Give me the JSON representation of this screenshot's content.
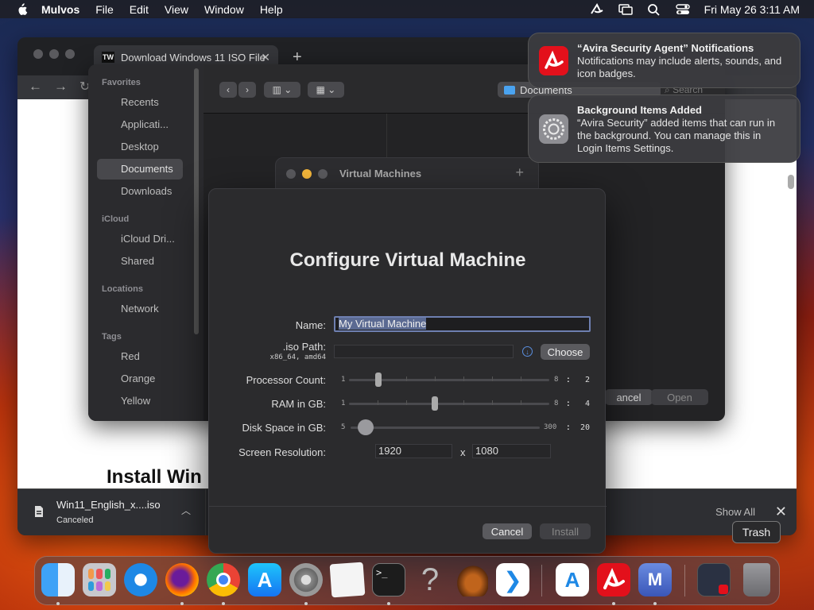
{
  "menubar": {
    "app_name": "Mulvos",
    "items": [
      "File",
      "Edit",
      "View",
      "Window",
      "Help"
    ],
    "datetime": "Fri May 26  3:11 AM"
  },
  "browser": {
    "tab_title": "Download Windows 11 ISO File",
    "favicon": "TW",
    "page_heading": "Install Win",
    "download": {
      "filename": "Win11_English_x....iso",
      "status": "Canceled"
    },
    "show_all": "Show All"
  },
  "finder": {
    "sections": [
      {
        "title": "Favorites",
        "items": [
          "Recents",
          "Applicati...",
          "Desktop",
          "Documents",
          "Downloads"
        ]
      },
      {
        "title": "iCloud",
        "items": [
          "iCloud Dri...",
          "Shared"
        ]
      },
      {
        "title": "Locations",
        "items": [
          "Network"
        ]
      },
      {
        "title": "Tags",
        "items": [
          "Red",
          "Orange",
          "Yellow"
        ]
      }
    ],
    "selected": "Documents",
    "path": "Documents",
    "search_placeholder": "Search",
    "cancel": "ancel",
    "open": "Open"
  },
  "vm_window": {
    "title": "Virtual Machines"
  },
  "dialog": {
    "title": "Configure Virtual Machine",
    "name_label": "Name:",
    "name_value": "My Virtual Machine",
    "iso_label": ".iso Path:",
    "iso_sublabel": "x86_64, amd64",
    "iso_value": "",
    "choose": "Choose",
    "processor": {
      "label": "Processor Count:",
      "min": "1",
      "max": "8",
      "value": "2"
    },
    "ram": {
      "label": "RAM in GB:",
      "min": "1",
      "max": "8",
      "value": "4"
    },
    "disk": {
      "label": "Disk Space in GB:",
      "min": "5",
      "max": "300",
      "value": "20"
    },
    "resolution": {
      "label": "Screen Resolution:",
      "width": "1920",
      "x": "x",
      "height": "1080"
    },
    "cancel": "Cancel",
    "install": "Install"
  },
  "notifications": [
    {
      "title": "“Avira Security Agent” Notifications",
      "body": "Notifications may include alerts, sounds, and icon badges."
    },
    {
      "title": "Background Items Added",
      "body": "“Avira Security” added items that can run in the background. You can manage this in Login Items Settings."
    }
  ],
  "dock": {
    "trash_tooltip": "Trash"
  },
  "colors": {
    "accent": "#5a8fe0",
    "avira_red": "#e3101b",
    "traffic_yellow": "#f5b73b"
  }
}
